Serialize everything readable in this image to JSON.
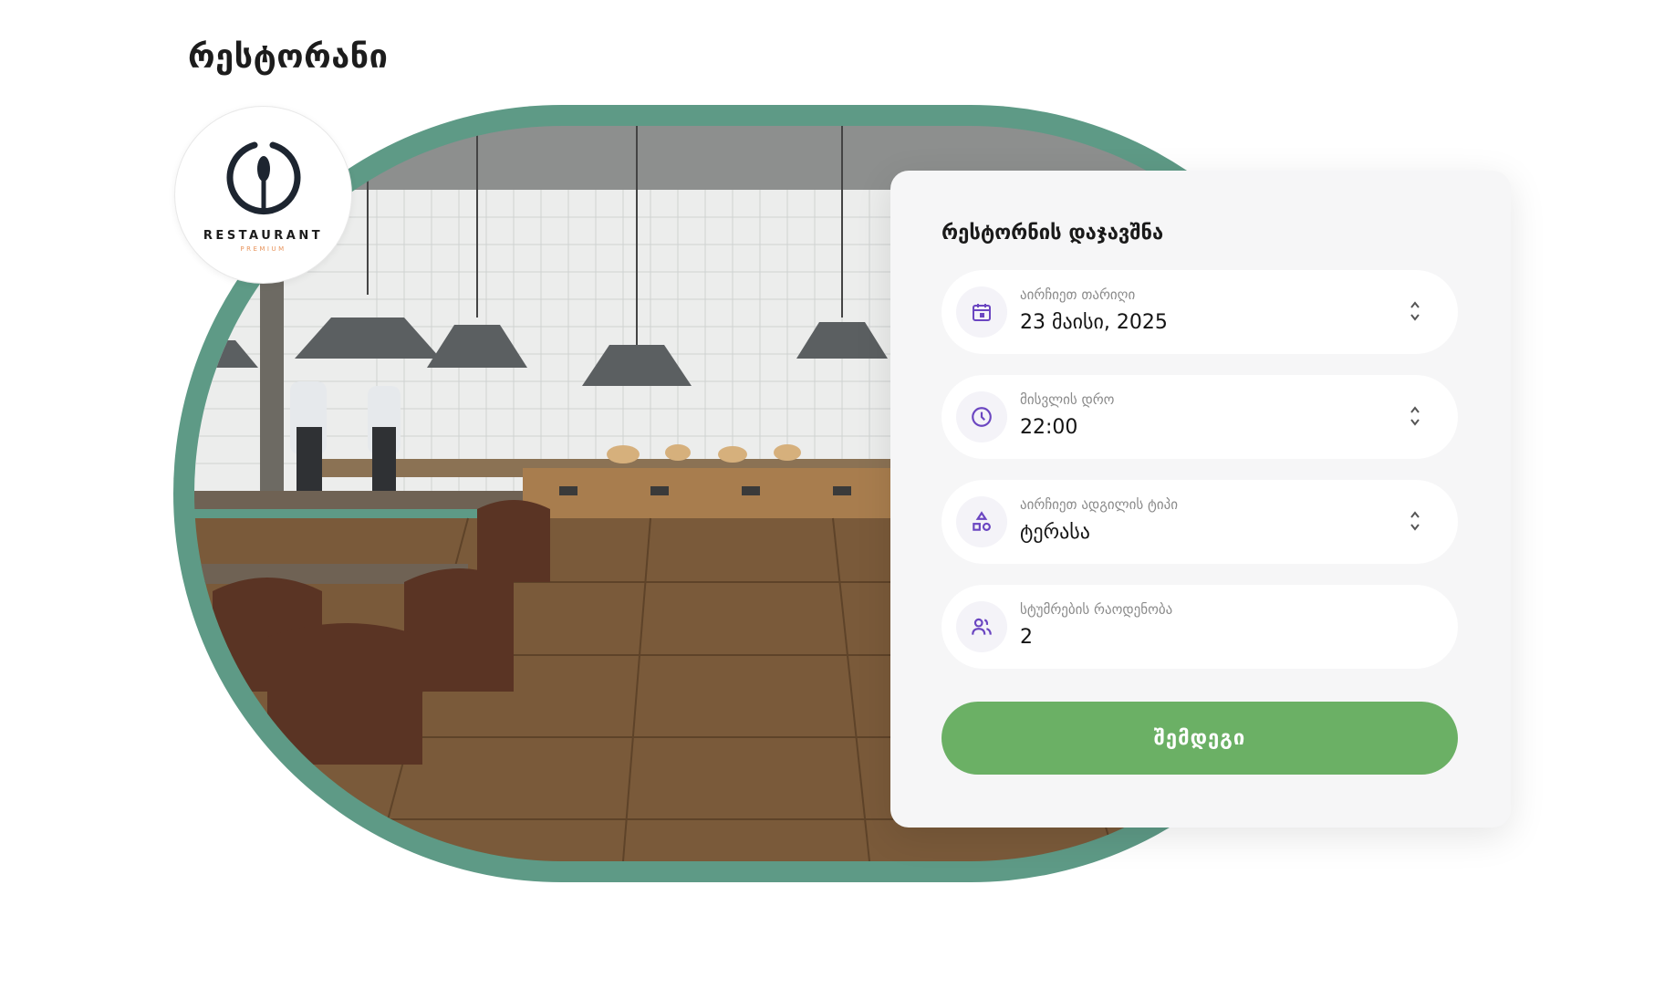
{
  "page": {
    "title": "რესტორანი"
  },
  "logo": {
    "name": "RESTAURANT",
    "subtitle": "PREMIUM"
  },
  "form": {
    "title": "რესტორნის დაჯავშნა",
    "fields": [
      {
        "label": "აირჩიეთ თარიღი",
        "value": "23 მაისი, 2025",
        "icon": "calendar-icon"
      },
      {
        "label": "მისვლის დრო",
        "value": "22:00",
        "icon": "clock-icon"
      },
      {
        "label": "აირჩიეთ ადგილის ტიპი",
        "value": "ტერასა",
        "icon": "shapes-icon"
      },
      {
        "label": "სტუმრების რაოდენობა",
        "value": "2",
        "icon": "users-icon"
      }
    ],
    "submit_label": "შემდეგი"
  },
  "colors": {
    "accent_purple": "#6b46c1",
    "button_green": "#6bb065",
    "frame_green": "#5e9a86",
    "logo_orange": "#e8945c"
  }
}
